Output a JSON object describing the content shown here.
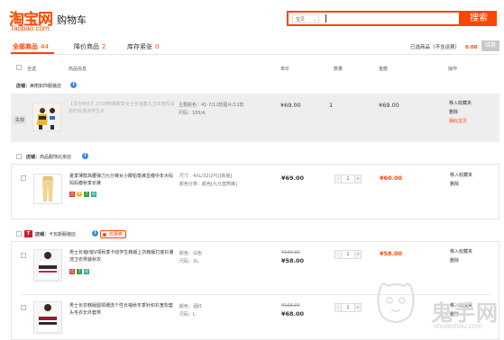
{
  "header": {
    "logo_cn": "淘宝网",
    "logo_en": "Taobao.com",
    "title": "购物车",
    "search_scope": "宝贝",
    "search_button": "搜索"
  },
  "tabs": [
    {
      "label": "全部商品",
      "count": "44"
    },
    {
      "label": "降价商品",
      "count": "2"
    },
    {
      "label": "库存紧张",
      "count": "0"
    }
  ],
  "summary": {
    "label": "已选商品（不含运费）",
    "amount": "0.00",
    "settle_button": "结算"
  },
  "columns": {
    "select_all": "全选",
    "info": "商品信息",
    "unit_price": "单价",
    "quantity": "数量",
    "amount": "金额",
    "action": "操作"
  },
  "shops": [
    {
      "label": "店铺：",
      "name": "美丽如你服装店",
      "items": [
        {
          "status": "失效",
          "title": "【清仓特价】2018韩版新款女士长袖套头卫衣宽松百搭时尚潮流学生衣",
          "prop1": "主要颜色：41-7/12款图片/12款",
          "prop2": "尺码：185/A",
          "price": "¥69.00",
          "quantity": "1",
          "amount": "¥69.00",
          "op1": "移入收藏夹",
          "op2": "删除",
          "op3": "相似宝贝"
        }
      ]
    },
    {
      "label": "店铺：",
      "name": "商品服饰北京店",
      "items": [
        {
          "title": "夏季薄款高腰弹力九分裤女小脚铅笔裤显瘦中年大码妈妈春秋季长裤",
          "prop1": "尺寸：4XL/32(2代)[新版]",
          "prop2": "颜色分类：颜色[九分直筒裤]",
          "price": "¥69.00",
          "quantity": "1",
          "amount": "¥60.00",
          "op1": "移入收藏夹",
          "op2": "删除"
        }
      ]
    },
    {
      "label": "店铺：",
      "name": "卡瓦斯服装店",
      "coupon": "优惠券",
      "items": [
        {
          "title": "男士长袖t恤V领秋季卡纹学生韩版上衣韩版打底衫潮流卫衣男装秋衣",
          "prop1": "颜色：白色",
          "prop2": "尺码：XL",
          "old_price": "¥199.00",
          "price": "¥58.00",
          "quantity": "1",
          "amount": "¥58.00",
          "op1": "移入收藏夹",
          "op2": "删除"
        },
        {
          "title": "男士长衣韩版圆领潮流个性长袖秋冬季针织衫宽松套头毛衣长外套男",
          "prop1": "颜色：酒红",
          "prop2": "尺码：L",
          "old_price": "¥168.00",
          "price": "¥68.00",
          "quantity": "1",
          "amount": "",
          "op1": "移入收藏夹",
          "op2": "删除"
        }
      ]
    }
  ],
  "watermark": {
    "text": "鬼手网",
    "sub": "shuaishou.com"
  },
  "colors": {
    "brand": "#ff4400",
    "info": "#3b8de4"
  }
}
